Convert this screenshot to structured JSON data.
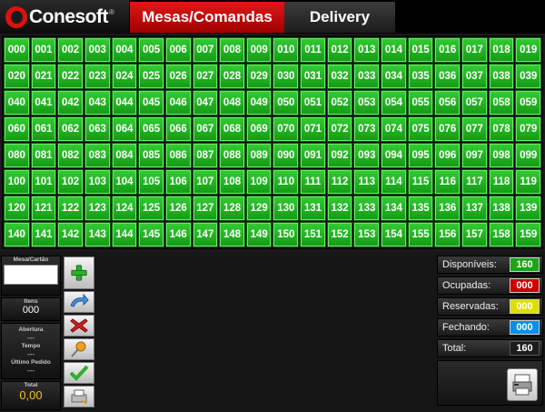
{
  "header": {
    "logo_text": "Conesoft",
    "logo_reg": "®",
    "tabs": [
      {
        "label": "Mesas/Comandas"
      },
      {
        "label": "Delivery"
      }
    ]
  },
  "tables": {
    "count": 160,
    "status_color": "#22bb22"
  },
  "left_panel": {
    "mesa_label": "Mesa/Cartão",
    "mesa_value": "",
    "itens_label": "Itens",
    "itens_value": "000",
    "abertura_label": "Abertura",
    "abertura_value": "---",
    "tempo_label": "Tempo",
    "tempo_value": "---",
    "ultimo_label": "Último Pedido",
    "ultimo_value": "---",
    "total_label": "Total",
    "total_value": "0,00"
  },
  "tools": [
    {
      "icon": "add-icon"
    },
    {
      "icon": "transfer-icon"
    },
    {
      "icon": "delete-icon"
    },
    {
      "icon": "pin-icon"
    },
    {
      "icon": "check-icon"
    },
    {
      "icon": "print-form-icon"
    }
  ],
  "legend": {
    "disponiveis_label": "Disponíveis:",
    "disponiveis_count": "160",
    "disponiveis_color": "#1aa51a",
    "ocupadas_label": "Ocupadas:",
    "ocupadas_count": "000",
    "ocupadas_color": "#cc0000",
    "reservadas_label": "Reservadas:",
    "reservadas_count": "000",
    "reservadas_color": "#dddd00",
    "fechando_label": "Fechando:",
    "fechando_count": "000",
    "fechando_color": "#0a8fe8",
    "total_label": "Total:",
    "total_count": "160"
  }
}
